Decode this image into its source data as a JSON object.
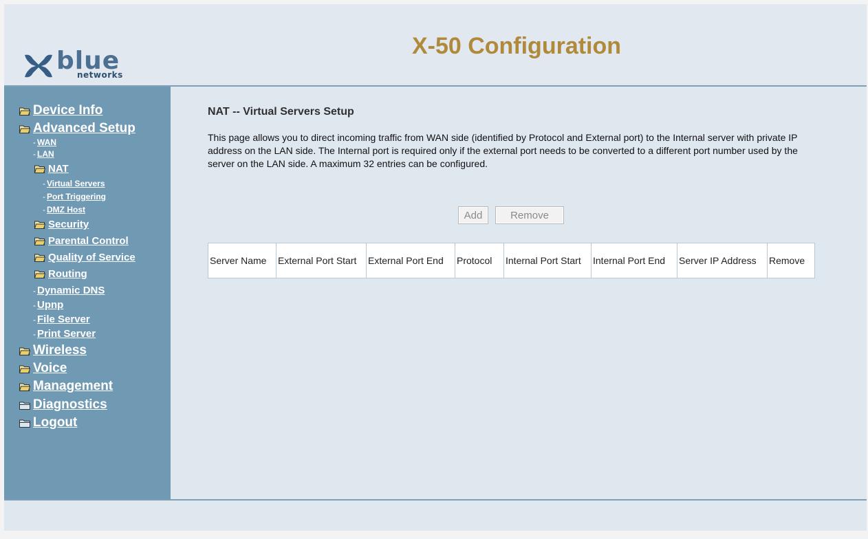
{
  "header": {
    "logo_text": "blue",
    "logo_subtext": "networks",
    "title": "X-50 Configuration"
  },
  "sidebar": {
    "items": [
      {
        "label": "Device Info",
        "level": 0,
        "icon": "folder-open-icon"
      },
      {
        "label": "Advanced Setup",
        "level": 0,
        "icon": "folder-open-icon"
      },
      {
        "label": "WAN",
        "level": 2
      },
      {
        "label": "LAN",
        "level": 2
      },
      {
        "label": "NAT",
        "level": 1,
        "icon": "folder-open-icon"
      },
      {
        "label": "Virtual Servers",
        "level": 2
      },
      {
        "label": "Port Triggering",
        "level": 2
      },
      {
        "label": "DMZ Host",
        "level": 2
      },
      {
        "label": "Security",
        "level": 1,
        "icon": "folder-open-icon"
      },
      {
        "label": "Parental Control",
        "level": 1,
        "icon": "folder-open-icon"
      },
      {
        "label": "Quality of Service",
        "level": 1,
        "icon": "folder-open-icon"
      },
      {
        "label": "Routing",
        "level": 1,
        "icon": "folder-open-icon"
      },
      {
        "label": "Dynamic DNS",
        "level": 1
      },
      {
        "label": "Upnp",
        "level": 1
      },
      {
        "label": "File Server",
        "level": 1
      },
      {
        "label": "Print Server",
        "level": 1
      },
      {
        "label": "Wireless",
        "level": 0,
        "icon": "folder-open-icon"
      },
      {
        "label": "Voice",
        "level": 0,
        "icon": "folder-open-icon"
      },
      {
        "label": "Management",
        "level": 0,
        "icon": "folder-open-icon"
      },
      {
        "label": "Diagnostics",
        "level": 0,
        "icon": "folder-closed-icon"
      },
      {
        "label": "Logout",
        "level": 0,
        "icon": "folder-closed-icon"
      }
    ]
  },
  "main": {
    "section_title": "NAT -- Virtual Servers Setup",
    "description": "This page allows you to direct incoming traffic from WAN side (identified by Protocol and External port) to the Internal server with private IP address on the LAN side. The Internal port is required only if the external port needs to be converted to a different port number used by the server on the LAN side. A maximum 32 entries can be configured.",
    "add_label": "Add",
    "remove_label": "Remove",
    "table": {
      "columns": [
        "Server Name",
        "External Port Start",
        "External Port End",
        "Protocol",
        "Internal Port Start",
        "Internal Port End",
        "Server IP Address",
        "Remove"
      ],
      "rows": []
    }
  },
  "colors": {
    "sidebar_bg": "#7099b4",
    "title_gold": "#b08a3a",
    "page_bg": "#dfe7ef"
  }
}
